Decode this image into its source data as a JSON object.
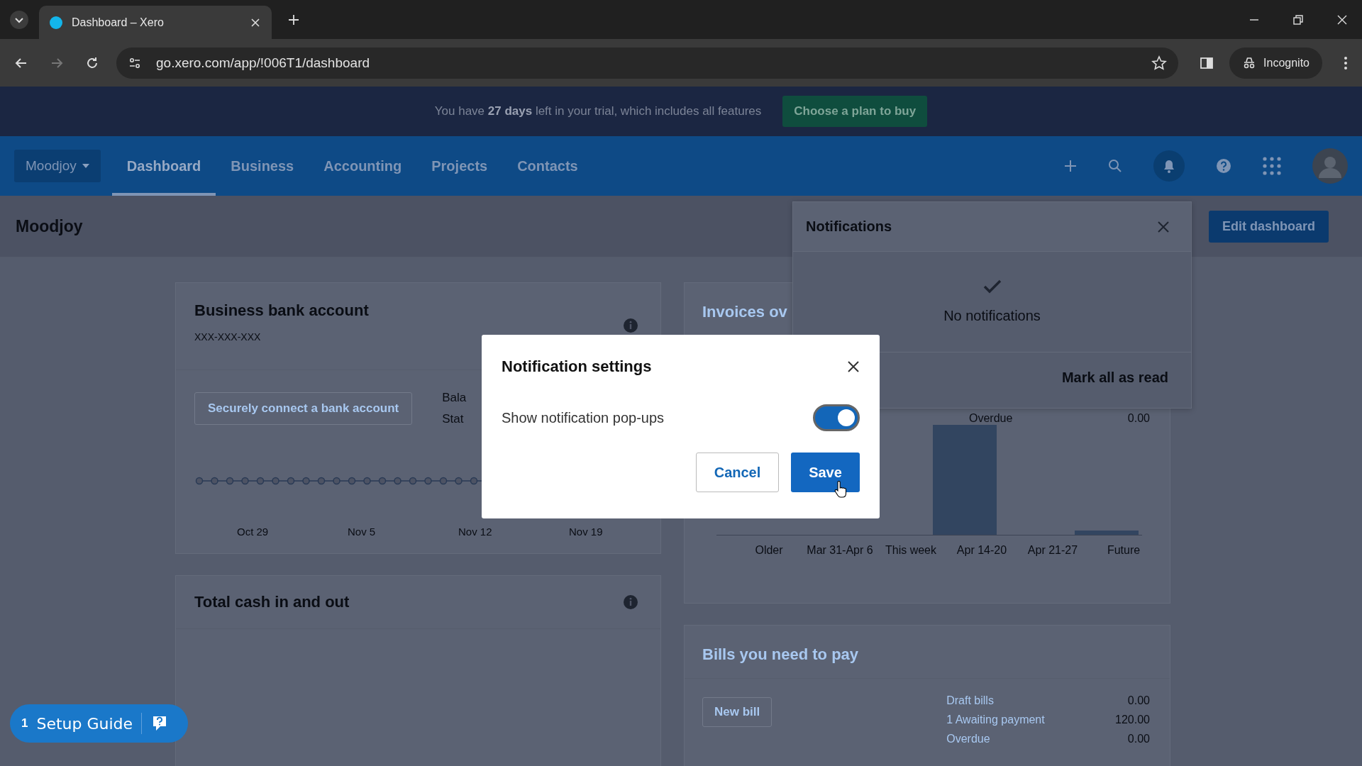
{
  "browser": {
    "tab_title": "Dashboard – Xero",
    "url": "go.xero.com/app/!006T1/dashboard",
    "profile": "Incognito"
  },
  "trial_banner": {
    "text": "You have **27 days** left in your trial, which includes all features",
    "button": "Choose a plan to buy"
  },
  "nav": {
    "org": "Moodjoy",
    "items": [
      {
        "label": "Dashboard",
        "selected": true
      },
      {
        "label": "Business",
        "selected": false
      },
      {
        "label": "Accounting",
        "selected": false
      },
      {
        "label": "Projects",
        "selected": false
      },
      {
        "label": "Contacts",
        "selected": false
      }
    ]
  },
  "page": {
    "title": "Moodjoy",
    "edit_button": "Edit dashboard"
  },
  "bank_card": {
    "title": "Business bank account",
    "account_mask": "XXX-XXX-XXX",
    "connect_button": "Securely connect a bank account",
    "labels": [
      "Bala",
      "Stat"
    ],
    "x_labels": [
      "Oct 29",
      "Nov 5",
      "Nov 12",
      "Nov 19"
    ]
  },
  "invoices_card": {
    "title": "Invoices ov",
    "overdue_label": "Overdue",
    "overdue_value": "0.00",
    "categories": [
      "Older",
      "Mar 31-Apr 6",
      "This week",
      "Apr 14-20",
      "Apr 21-27",
      "Future"
    ]
  },
  "cash_card": {
    "title": "Total cash in and out"
  },
  "bills_card": {
    "title": "Bills you need to pay",
    "new_button": "New bill",
    "rows": [
      {
        "label": "Draft bills",
        "value": "0.00"
      },
      {
        "label": "1 Awaiting payment",
        "value": "120.00"
      },
      {
        "label": "Overdue",
        "value": "0.00"
      }
    ]
  },
  "notifications": {
    "title": "Notifications",
    "empty_text": "No notifications",
    "mark_read": "Mark all as read"
  },
  "modal": {
    "title": "Notification settings",
    "toggle": {
      "label": "Show notification pop-ups",
      "on": true
    },
    "cancel": "Cancel",
    "save": "Save"
  },
  "setup_guide": {
    "count": "1",
    "label": "Setup Guide"
  }
}
